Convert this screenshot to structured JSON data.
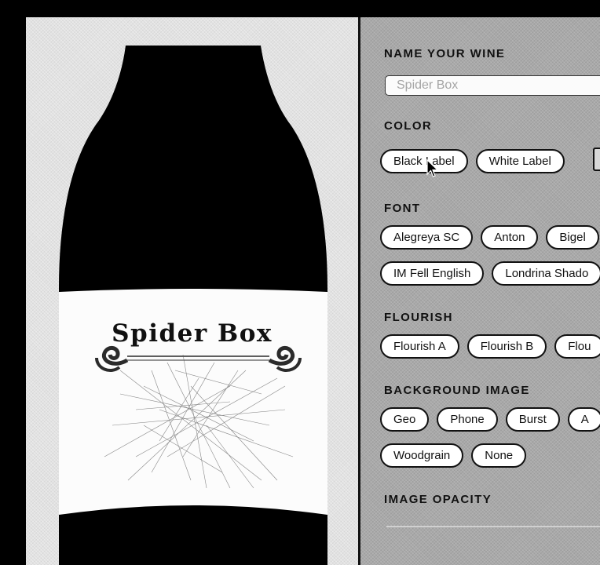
{
  "label": {
    "title": "Spider Box"
  },
  "panel": {
    "name": {
      "title": "NAME YOUR WINE",
      "value": "Spider Box"
    },
    "color": {
      "title": "COLOR",
      "options": [
        "Black Label",
        "White Label"
      ]
    },
    "font": {
      "title": "FONT",
      "row1": [
        "Alegreya SC",
        "Anton",
        "Bigel"
      ],
      "row2": [
        "IM Fell English",
        "Londrina Shado"
      ]
    },
    "flourish": {
      "title": "FLOURISH",
      "options": [
        "Flourish A",
        "Flourish B",
        "Flou"
      ]
    },
    "background": {
      "title": "BACKGROUND IMAGE",
      "row1": [
        "Geo",
        "Phone",
        "Burst",
        "A"
      ],
      "row2": [
        "Woodgrain",
        "None"
      ]
    },
    "opacity": {
      "title": "IMAGE OPACITY"
    }
  },
  "colors": {
    "panel": "#a9a9a9",
    "preview": "#e2e2e2",
    "bottle": "#000000",
    "label": "#fcfcfc",
    "pill": "#ffffff"
  },
  "icons": [
    "flourish-ornament",
    "spider-web-image",
    "mouse-pointer-icon"
  ]
}
